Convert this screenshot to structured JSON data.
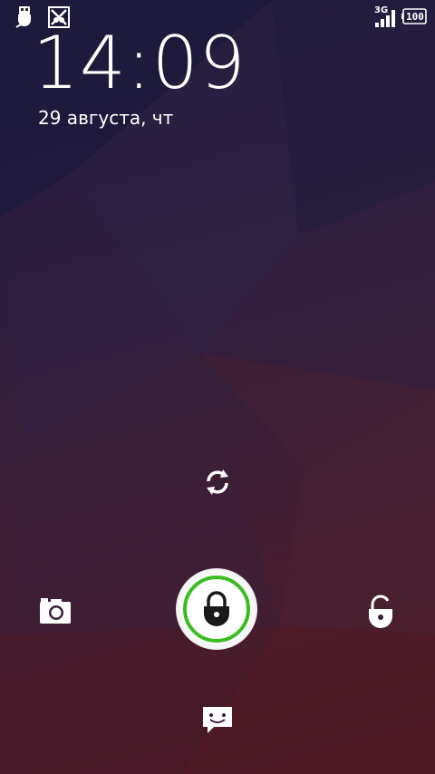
{
  "status_bar": {
    "left_icons": [
      "usb-debug-icon",
      "no-sim-icon"
    ],
    "network_type": "3G",
    "battery_level": "100",
    "signal_icon": "signal-bars-icon"
  },
  "lockscreen": {
    "time": "14:09",
    "date": "29 августа, чт"
  },
  "targets": {
    "top": "sync-icon",
    "left": "camera-icon",
    "right": "unlock-icon",
    "bottom": "message-icon",
    "center": "lock-icon"
  },
  "colors": {
    "accent_ring": "#3bbd22",
    "background_top": "#1d1a3a",
    "background_bottom": "#4a1420"
  }
}
